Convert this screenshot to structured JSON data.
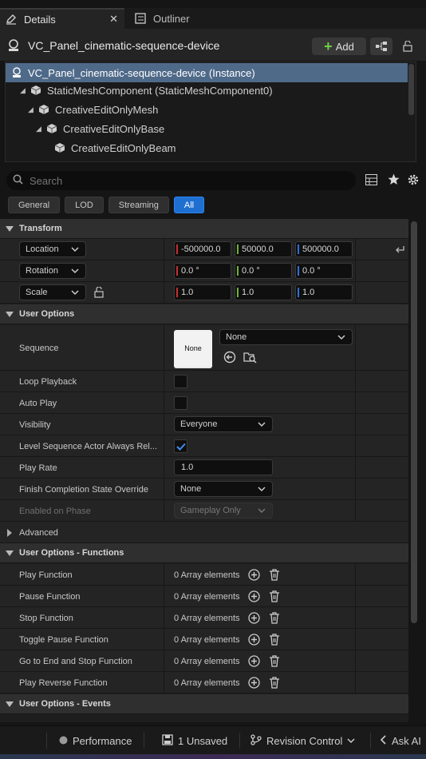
{
  "tabs": {
    "details": "Details",
    "outliner": "Outliner"
  },
  "header": {
    "title": "VC_Panel_cinematic-sequence-device",
    "add_label": "Add"
  },
  "tree": [
    {
      "label": "VC_Panel_cinematic-sequence-device (Instance)",
      "selected": true
    },
    {
      "label": "StaticMeshComponent (StaticMeshComponent0)"
    },
    {
      "label": "CreativeEditOnlyMesh"
    },
    {
      "label": "CreativeEditOnlyBase"
    },
    {
      "label": "CreativeEditOnlyBeam"
    }
  ],
  "search": {
    "placeholder": "Search"
  },
  "filters": [
    "General",
    "LOD",
    "Streaming",
    "All"
  ],
  "active_filter": "All",
  "transform": {
    "section": "Transform",
    "location": {
      "mode": "Location",
      "x": "-500000.0",
      "y": "50000.0",
      "z": "500000.0"
    },
    "rotation": {
      "mode": "Rotation",
      "x": "0.0 °",
      "y": "0.0 °",
      "z": "0.0 °"
    },
    "scale": {
      "mode": "Scale",
      "x": "1.0",
      "y": "1.0",
      "z": "1.0"
    }
  },
  "user_options": {
    "section": "User Options",
    "sequence": {
      "label": "Sequence",
      "thumb": "None",
      "value": "None"
    },
    "loop_playback": {
      "label": "Loop Playback",
      "checked": false
    },
    "auto_play": {
      "label": "Auto Play",
      "checked": false
    },
    "visibility": {
      "label": "Visibility",
      "value": "Everyone"
    },
    "level_sequence": {
      "label": "Level Sequence Actor Always Rel...",
      "checked": true
    },
    "play_rate": {
      "label": "Play Rate",
      "value": "1.0"
    },
    "finish_state": {
      "label": "Finish Completion State Override",
      "value": "None"
    },
    "enabled_phase": {
      "label": "Enabled on Phase",
      "value": "Gameplay Only"
    },
    "advanced": "Advanced"
  },
  "functions": {
    "section": "User Options - Functions",
    "items": [
      {
        "label": "Play Function",
        "value": "0 Array elements"
      },
      {
        "label": "Pause Function",
        "value": "0 Array elements"
      },
      {
        "label": "Stop Function",
        "value": "0 Array elements"
      },
      {
        "label": "Toggle Pause Function",
        "value": "0 Array elements"
      },
      {
        "label": "Go to End and Stop Function",
        "value": "0 Array elements"
      },
      {
        "label": "Play Reverse Function",
        "value": "0 Array elements"
      }
    ]
  },
  "events": {
    "section": "User Options - Events"
  },
  "status": {
    "performance": "Performance",
    "unsaved": "1 Unsaved",
    "revision": "Revision Control",
    "ask_ai": "Ask AI"
  },
  "colors": {
    "accent": "#1f6fd1",
    "selection": "#4f6a89",
    "add_green": "#6fcf4a"
  }
}
